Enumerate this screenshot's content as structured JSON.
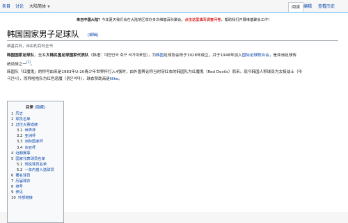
{
  "tabs": {
    "article": "条目",
    "talk": "讨论",
    "variant": "大陆简体",
    "read": "阅读",
    "edit": "编辑",
    "history": "查看历史"
  },
  "sitenotice": {
    "lead": "来自中国大陆？",
    "text": "今年夏天我们会在大陆地区举办多次维基百科聚会。",
    "highlight": "点击这里填写调查问卷",
    "tail": "，帮助我们开展维基聚会工作！"
  },
  "page": {
    "title": "韩国国家男子足球队",
    "edit_label": "[编辑]",
    "tagline": "维基百科，自由的百科全书"
  },
  "para1": {
    "subject": "韩国国家足球队",
    "t1": "，全名",
    "fullname": "大韩民国足球国家代表队",
    "t2": "（韩语：대한민국 축구 국가대표팀），为",
    "link1": "韩国",
    "t3": "足球协会所于1928年成立，并于1948年加入",
    "link2": "国际足球联合会",
    "t4": "，是亚洲足球传",
    "line2": "统劲旅之一",
    "ref": "[2]",
    "end": "。"
  },
  "para2": {
    "line1": "韩国队「红魔鬼」的称号由来是1983年U-20青少年世界杯打入4强时，由外国舆论称当时穿红衣的韩国队为红魔鬼（Red Devils）而来。现今韩国人称球员为太极战士（태",
    "line2a": "극전사），而称啦啦队为红色恶魔（붉은악마）。球衣赞助商是",
    "link": "Nike",
    "line2b": "。"
  },
  "toc": {
    "title": "目录",
    "toggle": "[隐藏]",
    "items": [
      {
        "num": "1",
        "label": "历史",
        "level": 1
      },
      {
        "num": "2",
        "label": "球员名单",
        "level": 1
      },
      {
        "num": "3",
        "label": "过往大赛成绩",
        "level": 1
      },
      {
        "num": "3.1",
        "label": "世界杯",
        "level": 2
      },
      {
        "num": "3.2",
        "label": "亚洲杯",
        "level": 2
      },
      {
        "num": "3.3",
        "label": "洲际国家杯",
        "level": 2
      },
      {
        "num": "3.4",
        "label": "东亚杯",
        "level": 2
      },
      {
        "num": "4",
        "label": "近期赛事",
        "level": 1
      },
      {
        "num": "5",
        "label": "国家代表球员名单",
        "level": 1
      },
      {
        "num": "5.1",
        "label": "现役球员名单",
        "level": 2
      },
      {
        "num": "5.2",
        "label": "一年内曾入选球员",
        "level": 2
      },
      {
        "num": "6",
        "label": "著名球员",
        "level": 1
      },
      {
        "num": "7",
        "label": "历届球衣",
        "level": 1
      },
      {
        "num": "8",
        "label": "绰号",
        "level": 1
      },
      {
        "num": "9",
        "label": "参见",
        "level": 1
      },
      {
        "num": "10",
        "label": "外部链接",
        "level": 1
      }
    ]
  }
}
